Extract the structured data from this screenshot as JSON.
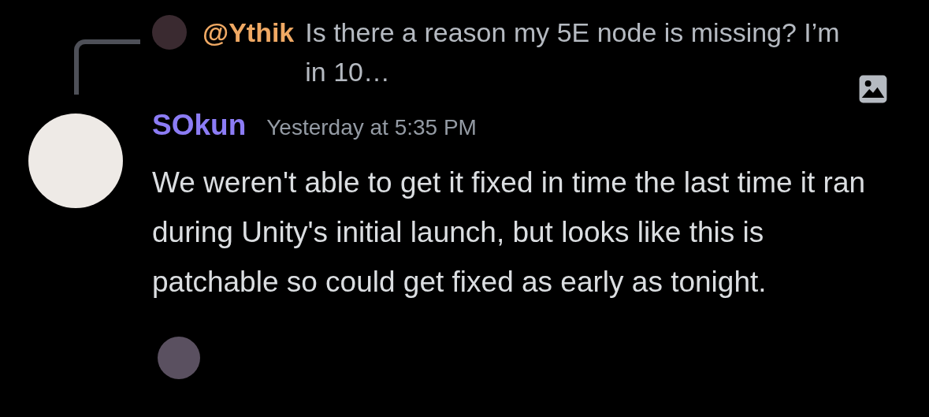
{
  "reply": {
    "author": "@Ythik",
    "text": "Is there a reason my 5E node is missing? I’m in 10…",
    "has_image": true
  },
  "message": {
    "author": "SOkun",
    "timestamp": "Yesterday at 5:35 PM",
    "text": "We weren't able to get it fixed in time the last time it ran during Unity's initial launch, but looks like this is patchable so could get fixed as early as tonight."
  }
}
